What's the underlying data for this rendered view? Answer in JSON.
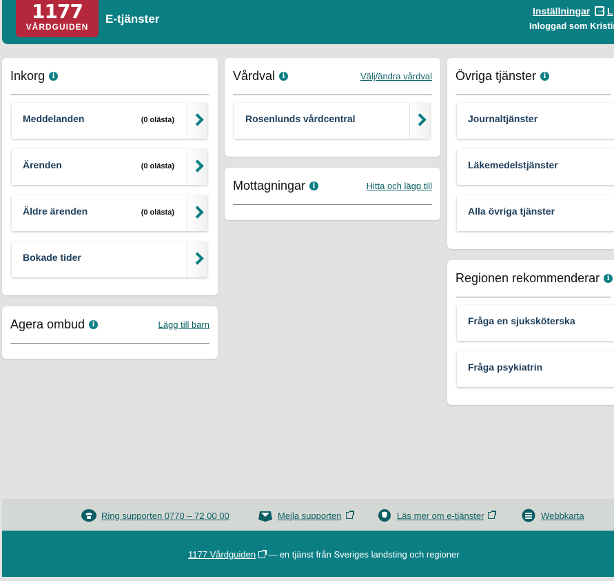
{
  "header": {
    "logo_number": "1177",
    "logo_sub": "VÅRDGUIDEN",
    "app_title": "E-tjänster",
    "settings_link": "Inställningar",
    "logout_label": "L",
    "logged_in_as": "Inloggad som Kristin"
  },
  "inkorg": {
    "title": "Inkorg",
    "items": [
      {
        "label": "Meddelanden",
        "count": "(0 olästa)"
      },
      {
        "label": "Ärenden",
        "count": "(0 olästa)"
      },
      {
        "label": "Äldre ärenden",
        "count": "(0 olästa)"
      },
      {
        "label": "Bokade tider",
        "count": ""
      }
    ]
  },
  "agera_ombud": {
    "title": "Agera ombud",
    "link": "Lägg till barn"
  },
  "vardval": {
    "title": "Vårdval",
    "link": "Välj/ändra vårdval",
    "items": [
      {
        "label": "Rosenlunds vårdcentral"
      }
    ]
  },
  "mottagningar": {
    "title": "Mottagningar",
    "link": "Hitta och lägg till"
  },
  "ovriga": {
    "title": "Övriga tjänster",
    "items": [
      {
        "label": "Journaltjänster"
      },
      {
        "label": "Läkemedelstjänster"
      },
      {
        "label": "Alla övriga tjänster"
      }
    ]
  },
  "regionen": {
    "title": "Regionen rekommenderar",
    "items": [
      {
        "label": "Fråga en sjuksköterska"
      },
      {
        "label": "Fråga psykiatrin"
      }
    ]
  },
  "footer": {
    "links": [
      {
        "label": "Ring supporten 0770 – 72 00 00",
        "icon": "phone-icon"
      },
      {
        "label": "Mejla supporten",
        "icon": "mail-icon"
      },
      {
        "label": "Läs mer om e-tjänster",
        "icon": "info-chat-icon"
      },
      {
        "label": "Webbkarta",
        "icon": "sitemap-icon"
      }
    ],
    "brand_link": "1177 Vårdguiden",
    "brand_suffix": "— en tjänst från Sveriges landsting och regioner"
  },
  "colors": {
    "brand_teal": "#0b7e84",
    "logo_red": "#b5283c",
    "background": "#e2e2e2"
  }
}
